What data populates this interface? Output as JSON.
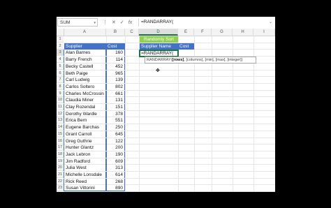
{
  "formula_bar": {
    "name_box": "SUM",
    "name_box_arrow": "▾",
    "cancel_icon": "✕",
    "enter_icon": "✓",
    "fx_label": "fx",
    "formula": "=RANDARRAY(",
    "expand_icon": "⌄"
  },
  "columns": [
    "A",
    "B",
    "C",
    "D",
    "E",
    "F",
    "G",
    "H",
    "I"
  ],
  "rows": [
    "1",
    "2",
    "3",
    "4",
    "5",
    "6",
    "7",
    "8",
    "9",
    "10",
    "11",
    "12",
    "13",
    "14",
    "15",
    "16",
    "17",
    "18",
    "19",
    "20",
    "21",
    "22",
    "23"
  ],
  "table": {
    "header_supplier": "Supplier",
    "header_cost": "Cost",
    "suppliers": [
      "Alan Barnes",
      "Barry French",
      "Becky Castell",
      "Beth Paige",
      "Carl Ludwig",
      "Carlos Soltero",
      "Charles McCrossin",
      "Claudia Miner",
      "Clay Rozendal",
      "Dorothy Wardle",
      "Erica Bern",
      "Eugene Barchas",
      "Grant Carroll",
      "Greg Guthrie",
      "Hunter Glantz",
      "Jack Lebron",
      "Jim Radford",
      "Julia West",
      "Michelle Lonsdale",
      "Rick Reed",
      "Susan Vittorini"
    ],
    "costs": [
      "160",
      "114",
      "452",
      "965",
      "139",
      "802",
      "661",
      "131",
      "151",
      "378",
      "551",
      "250",
      "645",
      "122",
      "200",
      "190",
      "609",
      "313",
      "614",
      "268",
      "890"
    ]
  },
  "sort_panel": {
    "title": "Randomly Sort",
    "header_supplier": "Supplier Name",
    "header_cost": "Cost",
    "active_cell": "=RANDARRAY(",
    "tooltip_fn": "RANDARRAY(",
    "tooltip_bold": "[rows]",
    "tooltip_rest": ", [columns], [min], [max], [integer])"
  },
  "colors": {
    "excel_green": "#217346",
    "header_blue": "#4472c4",
    "header_green": "#92d050"
  }
}
